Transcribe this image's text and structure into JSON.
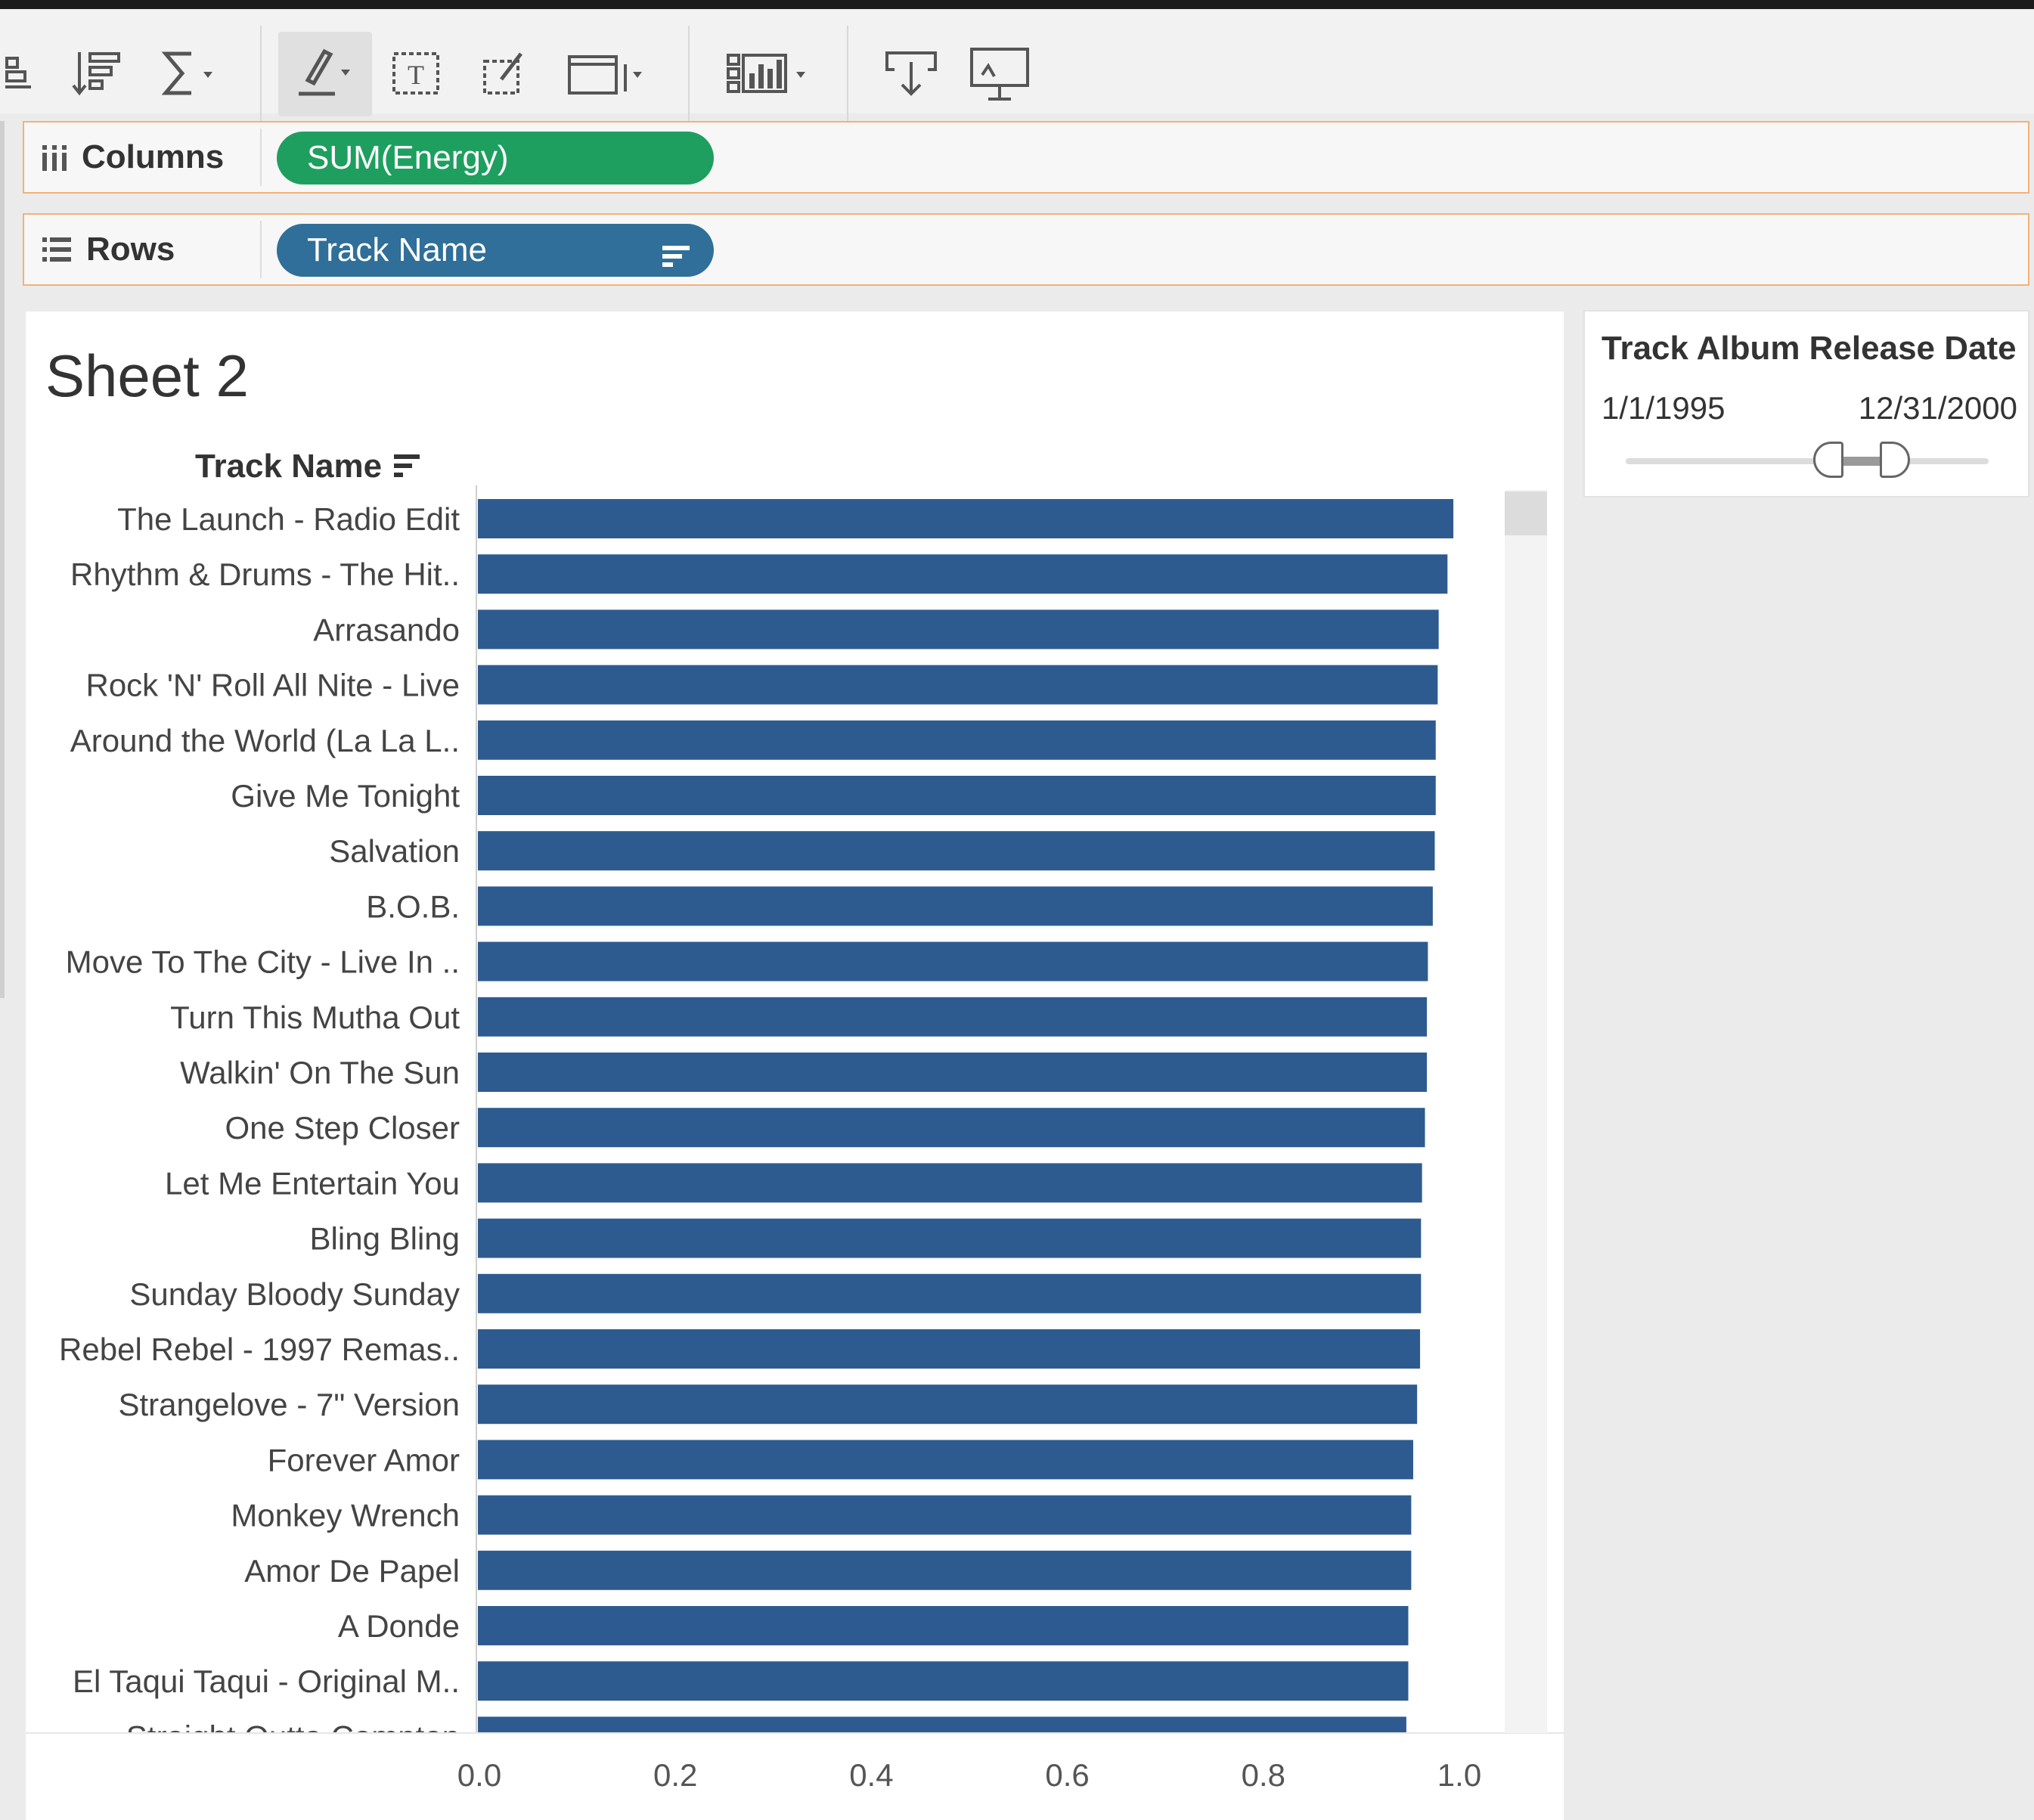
{
  "toolbar": {
    "icons": [
      "label-marks-icon",
      "sort-descending-icon",
      "totals-sum-icon",
      "highlight-pen-icon",
      "text-annotation-icon",
      "format-icon",
      "fit-width-icon",
      "show-me-icon",
      "download-icon",
      "presentation-icon"
    ]
  },
  "shelves": {
    "columns": {
      "label": "Columns",
      "pill": "SUM(Energy)"
    },
    "rows": {
      "label": "Rows",
      "pill": "Track Name"
    }
  },
  "sheet": {
    "title": "Sheet 2",
    "row_header": "Track Name"
  },
  "chart_data": {
    "type": "bar",
    "orientation": "horizontal",
    "categories": [
      "The Launch - Radio Edit",
      "Rhythm & Drums - The Hit..",
      "Arrasando",
      "Rock 'N' Roll All Nite - Live",
      "Around the World (La La L..",
      "Give Me Tonight",
      "Salvation",
      "B.O.B.",
      "Move To The City - Live In ..",
      "Turn This Mutha Out",
      "Walkin' On The Sun",
      "One Step Closer",
      "Let Me Entertain You",
      "Bling Bling",
      "Sunday Bloody Sunday",
      "Rebel Rebel - 1997 Remas..",
      "Strangelove - 7\" Version",
      "Forever Amor",
      "Monkey Wrench",
      "Amor De Papel",
      "A Donde",
      "El Taqui Taqui - Original M..",
      "Straight Outta Compton"
    ],
    "values": [
      0.997,
      0.991,
      0.982,
      0.981,
      0.979,
      0.979,
      0.978,
      0.976,
      0.971,
      0.97,
      0.97,
      0.968,
      0.965,
      0.964,
      0.964,
      0.963,
      0.96,
      0.956,
      0.954,
      0.954,
      0.951,
      0.951,
      0.949
    ],
    "xlim": [
      0,
      1.0
    ],
    "xticks": [
      "0.0",
      "0.2",
      "0.4",
      "0.6",
      "0.8",
      "1.0"
    ],
    "bar_color": "#2e5b8f",
    "grid": false
  },
  "filter": {
    "title": "Track Album Release Date",
    "min": "1/1/1995",
    "max": "12/31/2000"
  }
}
